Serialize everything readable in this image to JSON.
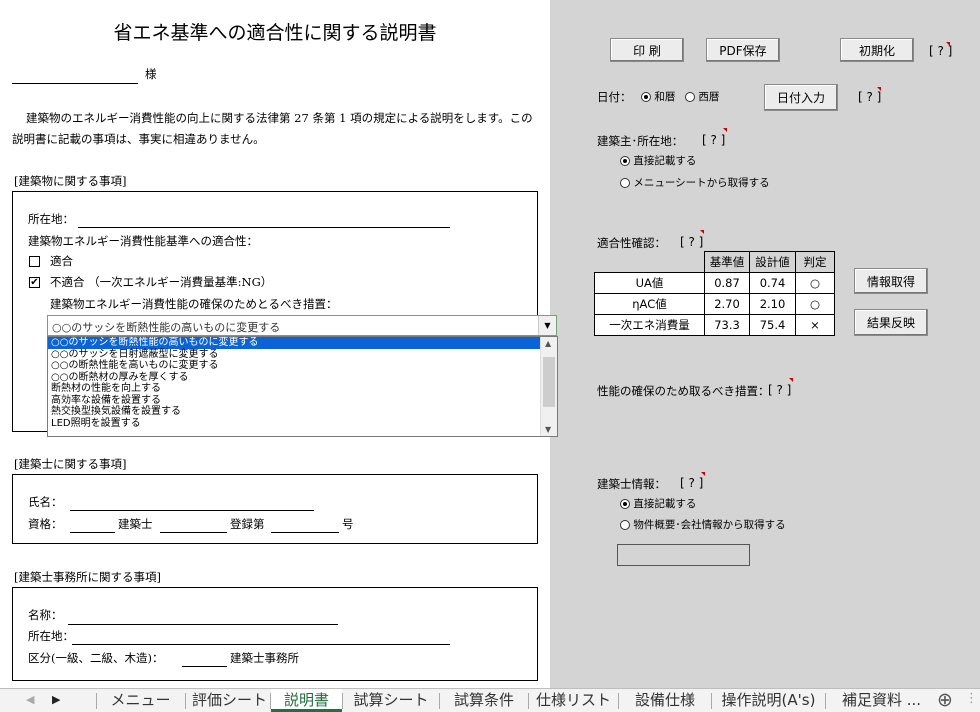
{
  "document": {
    "title": "省エネ基準への適合性に関する説明書",
    "honorific": "様",
    "intro_line1": "建築物のエネルギー消費性能の向上に関する法律第 27 条第 1 項の規定による説明をします。この",
    "intro_line2": "説明書に記載の事項は、事実に相違ありません。",
    "building_section": {
      "heading": "[建築物に関する事項]",
      "location_label": "所在地：",
      "conformity_label": "建築物エネルギー消費性能基準への適合性：",
      "option_conform": "適合",
      "option_nonconform": "不適合 （一次エネルギー消費量基準:NG）",
      "conform_checked": false,
      "nonconform_checked": true,
      "measures_label": "建築物エネルギー消費性能の確保のためとるべき措置：",
      "combo_value": "○○のサッシを断熱性能の高いものに変更する",
      "dropdown_items": [
        "○○のサッシを断熱性能の高いものに変更する",
        "○○のサッシを日射遮蔽型に変更する",
        "○○の断熱性能を高いものに変更する",
        "○○の断熱材の厚みを厚くする",
        "断熱材の性能を向上する",
        "高効率な設備を設置する",
        "熱交換型換気設備を設置する",
        "LED照明を設置する"
      ]
    },
    "architect_section": {
      "heading": "[建築士に関する事項]",
      "name_label": "氏名：",
      "qual_label": "資格：",
      "kenchikushi": "建築士",
      "reg_label": "登録第",
      "go": "号"
    },
    "office_section": {
      "heading": "[建築士事務所に関する事項]",
      "name_label": "名称：",
      "location_label": "所在地：",
      "class_label": "区分(一級、二級、木造)：",
      "office_suffix": "建築士事務所"
    }
  },
  "panel": {
    "print_button": "印 刷",
    "pdf_button": "PDF保存",
    "reset_button": "初期化",
    "help": "[ ? ]",
    "date_label": "日付：",
    "date_wareki": "和暦",
    "date_seireki": "西暦",
    "date_input_button": "日付入力",
    "owner_label": "建築主･所在地：",
    "owner_direct": "直接記載する",
    "owner_menu": "メニューシートから取得する",
    "check_label": "適合性確認：",
    "check_headers": [
      "基準値",
      "設計値",
      "判定"
    ],
    "check_rows": [
      {
        "name": "UA値",
        "std": "0.87",
        "design": "0.74",
        "judge": "○"
      },
      {
        "name": "ηAC値",
        "std": "2.70",
        "design": "2.10",
        "judge": "○"
      },
      {
        "name": "一次エネ消費量",
        "std": "73.3",
        "design": "75.4",
        "judge": "×"
      }
    ],
    "info_button": "情報取得",
    "reflect_button": "結果反映",
    "measures_label": "性能の確保のため取るべき措置：",
    "architect_label": "建築士情報：",
    "architect_direct": "直接記載する",
    "architect_company": "物件概要･会社情報から取得する"
  },
  "tabs": [
    "メニュー",
    "評価シート",
    "説明書",
    "試算シート",
    "試算条件",
    "仕様リスト",
    "設備仕様",
    "操作説明(A's)",
    "補足資料 ..."
  ],
  "active_tab": "説明書",
  "colors": {
    "accent": "#1e7145",
    "selection": "#0a64d8",
    "panel": "#d4d4d4",
    "flag": "#d00000"
  }
}
